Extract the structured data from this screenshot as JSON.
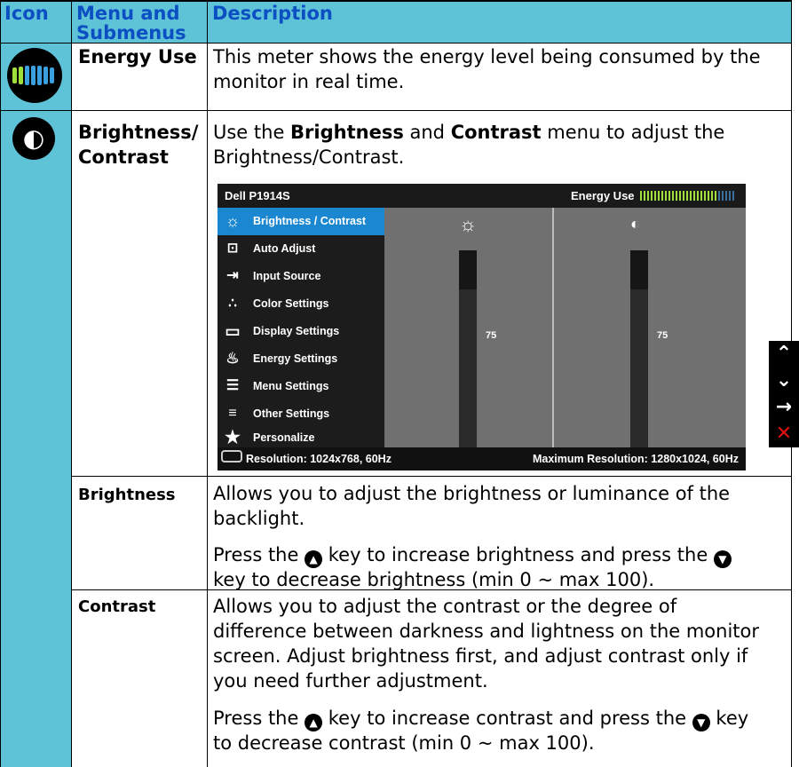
{
  "header": {
    "icon": "Icon",
    "menu_line1": "Menu and",
    "menu_line2": "Submenus",
    "description": "Description"
  },
  "rows": {
    "energy": {
      "icon": "energy-meter-icon",
      "title": "Energy Use",
      "desc_line1": "This meter shows the energy level being consumed by the",
      "desc_line2": "monitor in real time."
    },
    "brightness_contrast": {
      "icon": "brightness-contrast-icon",
      "title_line1": "Brightness/",
      "title_line2": "Contrast",
      "desc_pre": "Use the ",
      "desc_b1": "Brightness",
      "desc_mid": " and ",
      "desc_b2": "Contrast",
      "desc_post": " menu to adjust the",
      "desc_line2": "Brightness/Contrast."
    },
    "brightness": {
      "title": "Brightness",
      "p1_line1": "Allows you to adjust the brightness or luminance of the",
      "p1_line2": "backlight.",
      "p2_pre": "Press the ",
      "p2_mid": " key to increase brightness and press the ",
      "p2_line2": "key to decrease brightness (min 0 ~ max 100)."
    },
    "contrast": {
      "title": "Contrast",
      "p1_line1": "Allows you to adjust the contrast or the degree of",
      "p1_line2": "difference between darkness and lightness on the monitor",
      "p1_line3": "screen. Adjust brightness first, and adjust contrast only if",
      "p1_line4": "you need further adjustment.",
      "p2_pre": "Press the ",
      "p2_mid": "  key to increase contrast and press the ",
      "p2_post": " key",
      "p2_line2": "to decrease contrast (min 0 ~ max 100)."
    }
  },
  "osd": {
    "model": "Dell P1914S",
    "energy_label": "Energy Use",
    "energy_level": 0.8,
    "menu": [
      {
        "icon": "brightness-icon",
        "label": "Brightness / Contrast",
        "selected": true
      },
      {
        "icon": "auto-adjust-icon",
        "label": "Auto Adjust"
      },
      {
        "icon": "input-source-icon",
        "label": "Input Source"
      },
      {
        "icon": "color-settings-icon",
        "label": "Color Settings"
      },
      {
        "icon": "display-settings-icon",
        "label": "Display Settings"
      },
      {
        "icon": "energy-settings-icon",
        "label": "Energy Settings"
      },
      {
        "icon": "menu-settings-icon",
        "label": "Menu Settings"
      },
      {
        "icon": "other-settings-icon",
        "label": "Other Settings"
      },
      {
        "icon": "personalize-icon",
        "label": "Personalize"
      }
    ],
    "brightness_value": "75",
    "contrast_value": "75",
    "resolution": "Resolution: 1024x768,  60Hz",
    "max_resolution": "Maximum Resolution: 1280x1024,  60Hz"
  },
  "nav_buttons": [
    "up-arrow-icon",
    "down-arrow-icon",
    "right-arrow-icon",
    "close-icon"
  ],
  "colors": {
    "header_bg": "#5fc3d8",
    "header_text": "#0b4fc2",
    "osd_selected": "#1b87d0",
    "exit": "#e01010"
  }
}
